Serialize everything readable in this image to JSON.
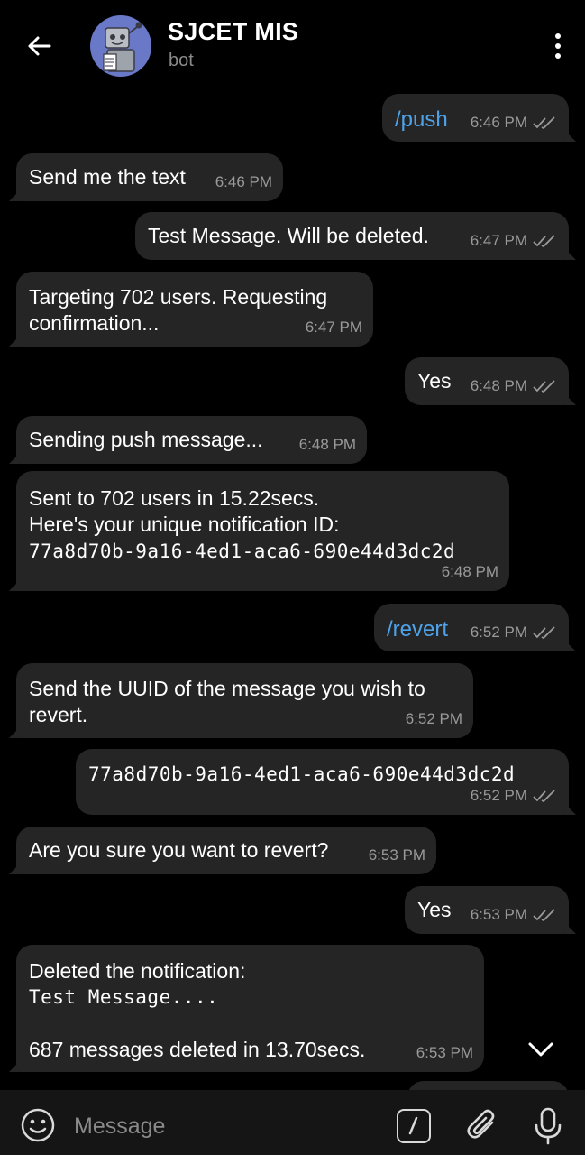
{
  "header": {
    "title": "SJCET MIS",
    "subtitle": "bot"
  },
  "messages": [
    {
      "dir": "out",
      "text": "/push",
      "time": "6:46 PM",
      "command": true
    },
    {
      "dir": "in",
      "text": "Send me the text",
      "time": "6:46 PM"
    },
    {
      "dir": "out",
      "text": "Test Message. Will be deleted.",
      "time": "6:47 PM"
    },
    {
      "dir": "in",
      "text": "Targeting 702 users. Requesting\nconfirmation...",
      "time": "6:47 PM"
    },
    {
      "dir": "out",
      "text": "Yes",
      "time": "6:48 PM"
    },
    {
      "dir": "in",
      "text": "Sending push message...",
      "time": "6:48 PM"
    },
    {
      "dir": "in",
      "line1": "Sent to 702 users in 15.22secs.",
      "line2": "Here's your unique notification ID:",
      "code": "77a8d70b-9a16-4ed1-aca6-690e44d3dc2d",
      "time": "6:48 PM"
    },
    {
      "dir": "out",
      "text": "/revert",
      "time": "6:52 PM",
      "command": true
    },
    {
      "dir": "in",
      "text": "Send the UUID of the message you wish to\nrevert.",
      "time": "6:52 PM"
    },
    {
      "dir": "out",
      "code": "77a8d70b-9a16-4ed1-aca6-690e44d3dc2d",
      "time": "6:52 PM"
    },
    {
      "dir": "in",
      "text": "Are you sure you want to revert?",
      "time": "6:53 PM"
    },
    {
      "dir": "out",
      "text": "Yes",
      "time": "6:53 PM"
    },
    {
      "dir": "in",
      "line1": "Deleted the notification:",
      "code": "Test Message....",
      "line3": "687 messages deleted in 13.70secs.",
      "time": "6:53 PM"
    }
  ],
  "composer": {
    "placeholder": "Message",
    "value": ""
  },
  "icons": {
    "back": "arrow-left-icon",
    "menu": "more-vertical-icon",
    "read": "double-check-icon",
    "scroll": "chevron-down-icon",
    "emoji": "emoji-icon",
    "command": "slash-command-icon",
    "attach": "paperclip-icon",
    "mic": "microphone-icon"
  },
  "colors": {
    "background": "#000000",
    "bubble": "#252525",
    "command_text": "#4ea2e8",
    "time_text": "#9a9a9a",
    "avatar_bg": "#6a78c8"
  }
}
